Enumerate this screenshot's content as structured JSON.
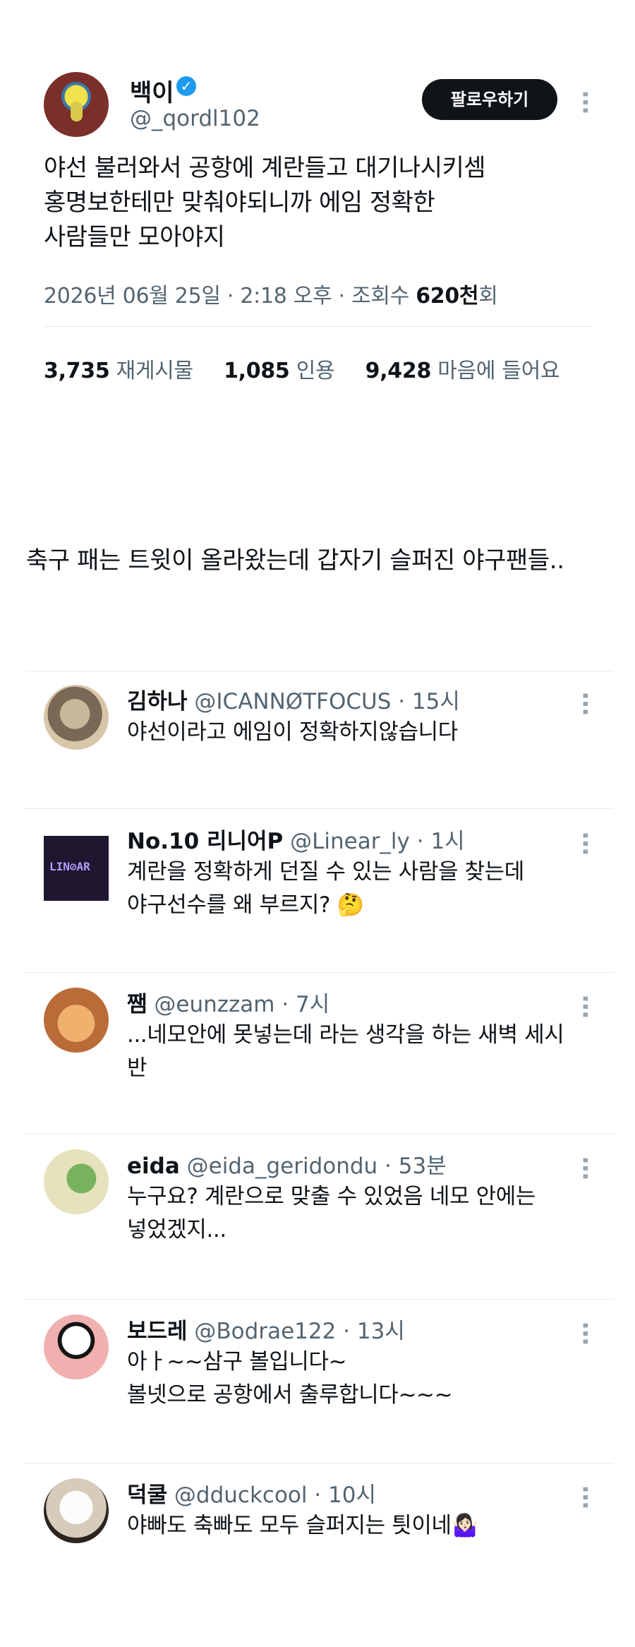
{
  "tweet": {
    "author_name": "백이",
    "handle": "@_qordl102",
    "follow_label": "팔로우하기",
    "lines": [
      "야선 불러와서 공항에 계란들고 대기나시키셈",
      "홍명보한테만 맞춰야되니까 에임 정확한",
      "사람들만 모아야지"
    ],
    "meta_prefix": "2026년 06월 25일 · 2:18 오후 · 조회수 ",
    "views": "620천",
    "views_suffix": "회",
    "stats": {
      "retweets": "3,735",
      "retweets_label": "재게시물",
      "quotes": "1,085",
      "quotes_label": "인용",
      "likes": "9,428",
      "likes_label": "마음에 들어요"
    }
  },
  "caption": "축구 패는 트윗이 올라왔는데 갑자기 슬퍼진 야구팬들..",
  "replies": [
    {
      "name": "김하나",
      "meta": " @ICANNØTFOCUS · 15시",
      "lines": [
        "야선이라고 에임이 정확하지않습니다"
      ]
    },
    {
      "name": "No.10 리니어P",
      "meta": " @Linear_ly · 1시",
      "lines": [
        "계란을 정확하게 던질 수 있는 사람을 찾는데",
        "야구선수를 왜 부르지? 🤔"
      ]
    },
    {
      "name": "쨈",
      "meta": " @eunzzam · 7시",
      "lines": [
        "...네모안에 못넣는데 라는 생각을 하는 새벽 세시",
        "반"
      ]
    },
    {
      "name": "eida",
      "meta": " @eida_geridondu · 53분",
      "lines": [
        "누구요? 계란으로 맞출 수 있었음 네모 안에는",
        "넣었겠지..."
      ]
    },
    {
      "name": "보드레",
      "meta": " @Bodrae122 · 13시",
      "lines": [
        "아ㅏ~~삼구 볼입니다~",
        "볼넷으로 공항에서 출루합니다~~~"
      ]
    },
    {
      "name": "덕쿨",
      "meta": " @dduckcool · 10시",
      "lines": [
        "야빠도 축빠도 모두 슬퍼지는 틧이네🤷🏻‍♀️"
      ]
    }
  ],
  "icons": {
    "more": "more-vertical-icon",
    "verified": "verified-badge-icon"
  },
  "colors": {
    "text": "#0f1419",
    "muted": "#536471",
    "verified": "#1d9bf0",
    "button": "#0f1419"
  }
}
